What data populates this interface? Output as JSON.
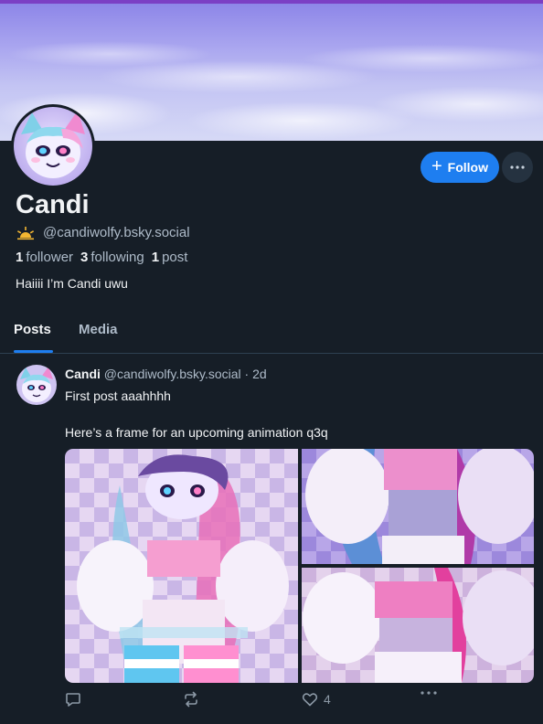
{
  "profile": {
    "display_name": "Candi",
    "handle": "@candiwolfy.bsky.social",
    "followers_count": "1",
    "followers_label": "follower",
    "following_count": "3",
    "following_label": "following",
    "posts_count": "1",
    "posts_label": "post",
    "bio": "Haiiii I’m Candi uwu"
  },
  "actions": {
    "follow_label": "Follow"
  },
  "tabs": [
    {
      "label": "Posts",
      "active": true
    },
    {
      "label": "Media",
      "active": false
    }
  ],
  "post": {
    "author_name": "Candi",
    "author_handle": "@candiwolfy.bsky.social",
    "time": "· 2d",
    "text_line1": "First post aaahhhh",
    "text_line2": "Here’s a frame for an upcoming animation q3q",
    "like_count": "4"
  },
  "colors": {
    "background": "#161e27",
    "accent": "#1e7ef0",
    "muted_text": "#aebbc9"
  },
  "icons": [
    "sun-icon",
    "plus-icon",
    "ellipsis-icon",
    "reply-icon",
    "repost-icon",
    "heart-icon"
  ]
}
